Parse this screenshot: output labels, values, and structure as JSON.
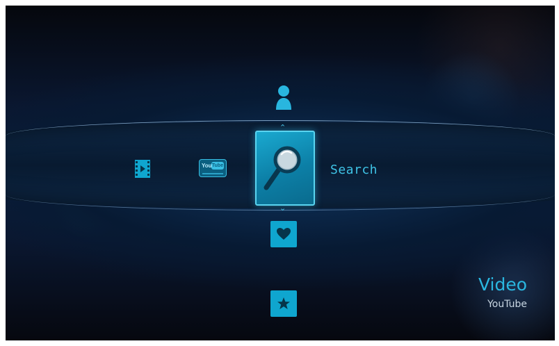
{
  "menu": {
    "selected_label": "Search",
    "up_arrow": "⌃",
    "down_arrow": "⌄",
    "items": [
      {
        "name": "video-library",
        "icon": "film-play-icon"
      },
      {
        "name": "youtube",
        "icon": "youtube-logo-icon",
        "logo_text_left": "You",
        "logo_text_right": "Tube"
      },
      {
        "name": "search",
        "icon": "magnifier-icon",
        "selected": true
      },
      {
        "name": "account",
        "icon": "user-icon"
      },
      {
        "name": "favorites",
        "icon": "heart-icon"
      },
      {
        "name": "featured",
        "icon": "star-icon"
      }
    ]
  },
  "brand": {
    "title": "Video",
    "subtitle": "YouTube"
  },
  "colors": {
    "accent": "#0fa6cf",
    "highlight_border": "#5ad4f0",
    "label_text": "#3fc3e6",
    "subtitle_text": "#c8d6e2",
    "background_dark": "#06080f"
  }
}
